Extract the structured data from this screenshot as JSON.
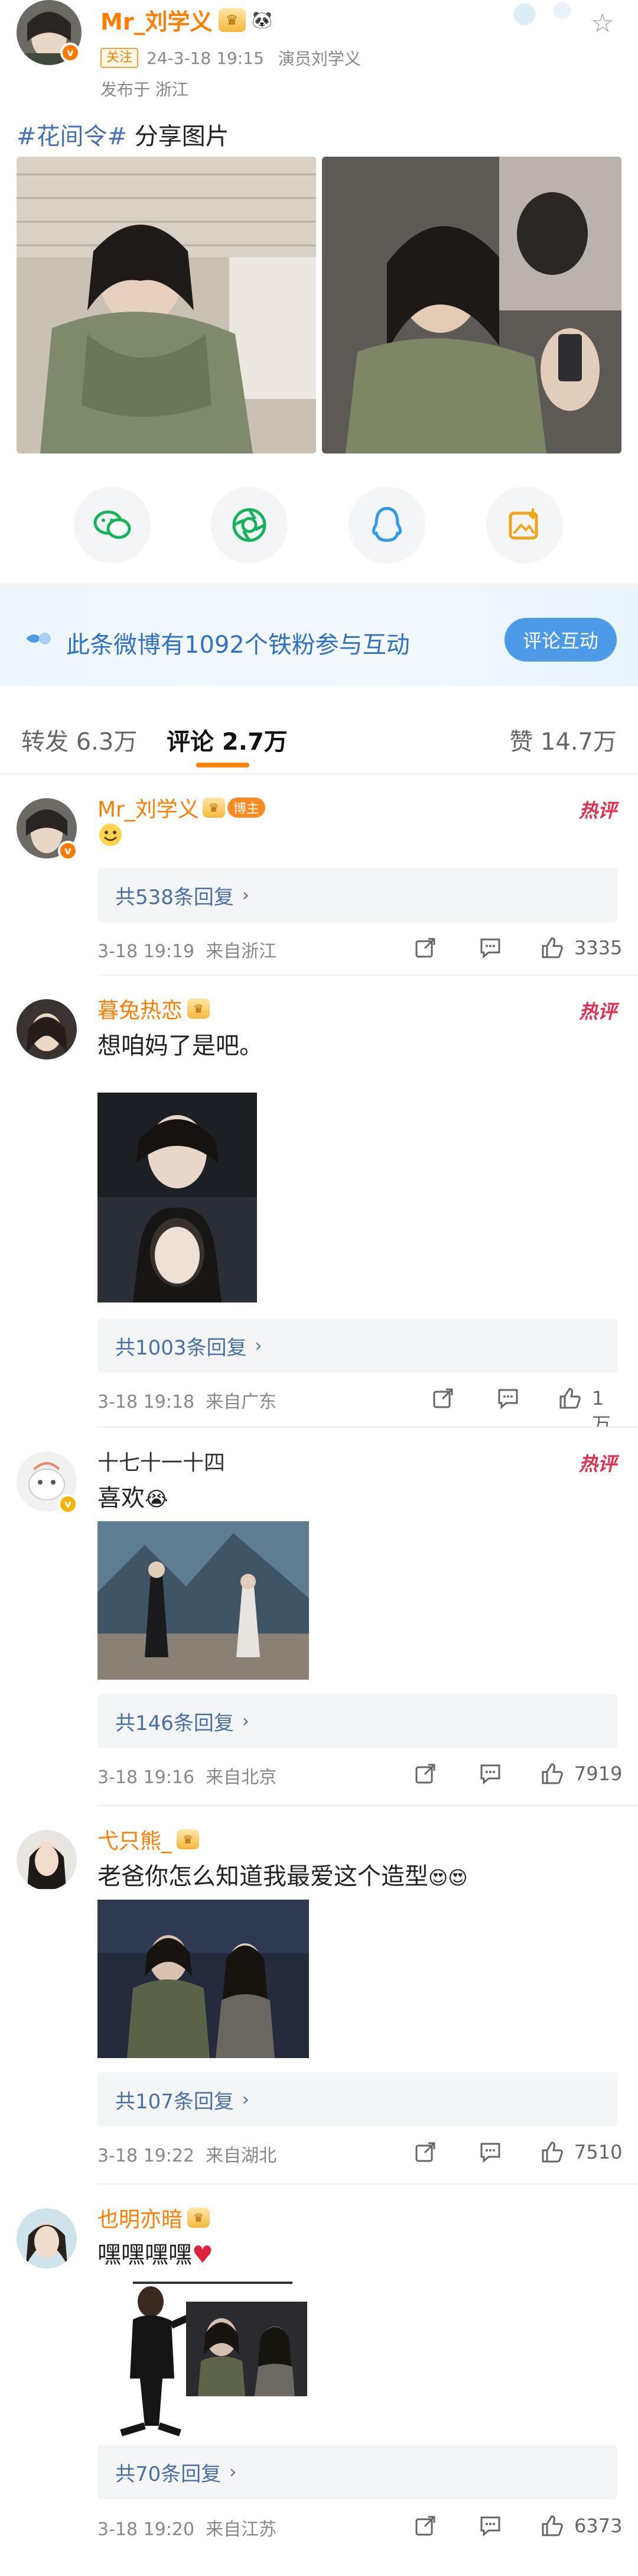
{
  "post": {
    "author": "Mr_刘学义",
    "follow_tag": "关注",
    "time": "24-3-18 19:15",
    "role": "演员刘学义",
    "location": "发布于 浙江",
    "topic": "#花间令#",
    "text": "分享图片"
  },
  "banner": {
    "text": "此条微博有1092个铁粉参与互动",
    "button": "评论互动"
  },
  "tabs": {
    "repost": "转发 6.3万",
    "comment": "评论 2.7万",
    "like": "赞 14.7万"
  },
  "hot_label": "热评",
  "comments": [
    {
      "name": "Mr_刘学义",
      "tag": "博主",
      "text": "",
      "replies": "共538条回复",
      "time": "3-18 19:19",
      "location": "来自浙江",
      "likes": "3335"
    },
    {
      "name": "暮兔热恋",
      "text": "想咱妈了是吧。",
      "replies": "共1003条回复",
      "time": "3-18 19:18",
      "location": "来自广东",
      "likes": "1万"
    },
    {
      "name": "十七十一十四",
      "text": "喜欢",
      "replies": "共146条回复",
      "time": "3-18 19:16",
      "location": "来自北京",
      "likes": "7919"
    },
    {
      "name": "弋只熊_",
      "text": "老爸你怎么知道我最爱这个造型",
      "replies": "共107条回复",
      "time": "3-18 19:22",
      "location": "来自湖北",
      "likes": "7510"
    },
    {
      "name": "也明亦暗",
      "text": "嘿嘿嘿嘿",
      "replies": "共70条回复",
      "time": "3-18 19:20",
      "location": "来自江苏",
      "likes": "6373"
    }
  ],
  "colors": {
    "accent": "#ff8200",
    "link": "#4a6fa5",
    "hot": "#e0304d",
    "name": "#ff7d00"
  }
}
